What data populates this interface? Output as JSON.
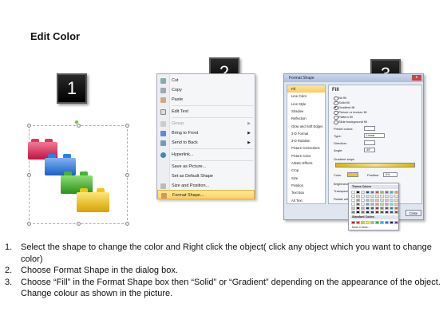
{
  "title": "Edit Color",
  "steps": [
    "1",
    "2",
    "3"
  ],
  "context_menu": {
    "items": [
      {
        "label": "Cut",
        "underline": "t"
      },
      {
        "label": "Copy"
      },
      {
        "label": "Paste"
      },
      {
        "label": "Edit Text"
      },
      {
        "label": "Group",
        "disabled": true,
        "submenu": true
      },
      {
        "label": "Bring to Front",
        "submenu": true
      },
      {
        "label": "Send to Back",
        "submenu": true
      },
      {
        "label": "Hyperlink..."
      },
      {
        "label": "Save as Picture..."
      },
      {
        "label": "Set as Default Shape"
      },
      {
        "label": "Size and Position..."
      },
      {
        "label": "Format Shape...",
        "highlighted": true
      }
    ]
  },
  "dialog": {
    "title": "Format Shape",
    "close_x": "x",
    "left_items": [
      "Fill",
      "Line Color",
      "Line Style",
      "Shadow",
      "Reflection",
      "Glow and Soft Edges",
      "3-D Format",
      "3-D Rotation",
      "Picture Corrections",
      "Picture Color",
      "Artistic Effects",
      "Crop",
      "Size",
      "Position",
      "Text Box",
      "Alt Text"
    ],
    "selected_left": "Fill",
    "fill_heading": "Fill",
    "fill_options": [
      "No fill",
      "Solid fill",
      "Gradient fill",
      "Picture or texture fill",
      "Pattern fill",
      "Slide background fill"
    ],
    "selected_fill": "Gradient fill",
    "preset_label": "Preset colors:",
    "type_label": "Type:",
    "type_value": "Linear",
    "direction_label": "Direction:",
    "angle_label": "Angle:",
    "angle_value": "45°",
    "stops_label": "Gradient stops",
    "color_label": "Color",
    "position_label": "Position:",
    "position_value": "0%",
    "brightness_label": "Brightness:",
    "transparency_label": "Transparency:",
    "rotate_label": "Rotate with shape",
    "close_label": "Close"
  },
  "palette": {
    "theme_label": "Theme Colors",
    "standard_label": "Standard Colors",
    "more_label": "More Colors...",
    "theme_row": [
      "#ffffff",
      "#000000",
      "#eeece1",
      "#1f497d",
      "#4f81bd",
      "#c0504d",
      "#9bbb59",
      "#8064a2",
      "#4bacc6",
      "#f79646"
    ],
    "standard_row": [
      "#c00000",
      "#ff0000",
      "#ffc000",
      "#ffff00",
      "#92d050",
      "#00b050",
      "#00b0f0",
      "#0070c0",
      "#002060",
      "#7030a0"
    ]
  },
  "lego_colors": [
    "#e0345a",
    "#2f7fe0",
    "#44b52f",
    "#f2c417"
  ],
  "instructions": [
    {
      "num": "1.",
      "text": "Select the shape to change the color and Right click the object( click any object which you want to change color)"
    },
    {
      "num": "2.",
      "text": "Choose Format Shape in the dialog box."
    },
    {
      "num": "3.",
      "text": "Choose “Fill” in the Format Shape box then “Solid” or “Gradient” depending on the appearance of the object. Change colour as shown in the picture."
    }
  ]
}
